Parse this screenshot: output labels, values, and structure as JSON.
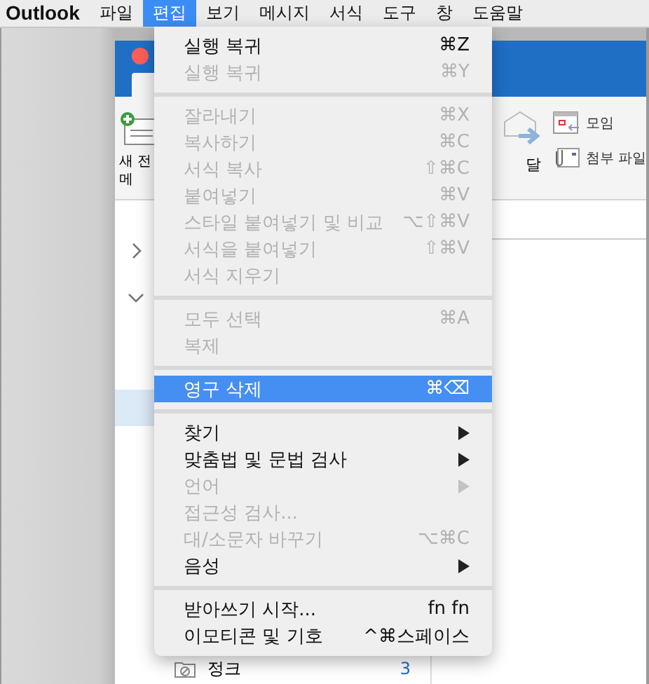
{
  "menubar": {
    "items": [
      {
        "label": "Outlook",
        "kind": "app",
        "selected": false
      },
      {
        "label": "파일",
        "kind": "menu",
        "selected": false
      },
      {
        "label": "편집",
        "kind": "menu",
        "selected": true
      },
      {
        "label": "보기",
        "kind": "menu",
        "selected": false
      },
      {
        "label": "메시지",
        "kind": "menu",
        "selected": false
      },
      {
        "label": "서식",
        "kind": "menu",
        "selected": false
      },
      {
        "label": "도구",
        "kind": "menu",
        "selected": false
      },
      {
        "label": "창",
        "kind": "menu",
        "selected": false
      },
      {
        "label": "도움말",
        "kind": "menu",
        "selected": false
      }
    ]
  },
  "window": {
    "ribbon": {
      "new_item_lines": [
        "새 전",
        "메"
      ],
      "forward_label": "달",
      "buttons": [
        {
          "label": "모임",
          "kind": "meeting"
        },
        {
          "label": "첨부 파일",
          "kind": "attach"
        }
      ]
    },
    "folders": [
      {
        "label": "정크",
        "count": "3"
      }
    ]
  },
  "menu": {
    "items": [
      {
        "kind": "item",
        "label": "실행 복귀",
        "shortcut": "⌘Z",
        "disabled": false,
        "selected": false,
        "submenu": false
      },
      {
        "kind": "item",
        "label": "실행 복귀",
        "shortcut": "⌘Y",
        "disabled": true,
        "selected": false,
        "submenu": false
      },
      {
        "kind": "separator"
      },
      {
        "kind": "item",
        "label": "잘라내기",
        "shortcut": "⌘X",
        "disabled": true,
        "selected": false,
        "submenu": false
      },
      {
        "kind": "item",
        "label": "복사하기",
        "shortcut": "⌘C",
        "disabled": true,
        "selected": false,
        "submenu": false
      },
      {
        "kind": "item",
        "label": "서식 복사",
        "shortcut": "⇧⌘C",
        "disabled": true,
        "selected": false,
        "submenu": false
      },
      {
        "kind": "item",
        "label": "붙여넣기",
        "shortcut": "⌘V",
        "disabled": true,
        "selected": false,
        "submenu": false
      },
      {
        "kind": "item",
        "label": "스타일 붙여넣기 및 비교",
        "shortcut": "⌥⇧⌘V",
        "disabled": true,
        "selected": false,
        "submenu": false
      },
      {
        "kind": "item",
        "label": "서식을 붙여넣기",
        "shortcut": "⇧⌘V",
        "disabled": true,
        "selected": false,
        "submenu": false
      },
      {
        "kind": "item",
        "label": "서식 지우기",
        "disabled": true,
        "selected": false,
        "submenu": false
      },
      {
        "kind": "separator"
      },
      {
        "kind": "item",
        "label": "모두 선택",
        "shortcut": "⌘A",
        "disabled": true,
        "selected": false,
        "submenu": false
      },
      {
        "kind": "item",
        "label": "복제",
        "disabled": true,
        "selected": false,
        "submenu": false
      },
      {
        "kind": "separator"
      },
      {
        "kind": "item",
        "label": "영구 삭제",
        "shortcut": "⌘⌫",
        "disabled": false,
        "selected": true,
        "submenu": false
      },
      {
        "kind": "separator"
      },
      {
        "kind": "item",
        "label": "찾기",
        "disabled": false,
        "selected": false,
        "submenu": true
      },
      {
        "kind": "item",
        "label": "맞춤법 및 문법 검사",
        "disabled": false,
        "selected": false,
        "submenu": true
      },
      {
        "kind": "item",
        "label": "언어",
        "disabled": true,
        "selected": false,
        "submenu": true
      },
      {
        "kind": "item",
        "label": "접근성 검사...",
        "disabled": true,
        "selected": false,
        "submenu": false
      },
      {
        "kind": "item",
        "label": "대/소문자 바꾸기",
        "shortcut": "⌥⌘C",
        "disabled": true,
        "selected": false,
        "submenu": false
      },
      {
        "kind": "item",
        "label": "음성",
        "disabled": false,
        "selected": false,
        "submenu": true
      },
      {
        "kind": "separator"
      },
      {
        "kind": "item",
        "label": "받아쓰기 시작...",
        "shortcut": "fn fn",
        "disabled": false,
        "selected": false,
        "submenu": false
      },
      {
        "kind": "item",
        "label": "이모티콘 및 기호",
        "shortcut": "^⌘스페이스",
        "disabled": false,
        "selected": false,
        "submenu": false
      }
    ]
  }
}
